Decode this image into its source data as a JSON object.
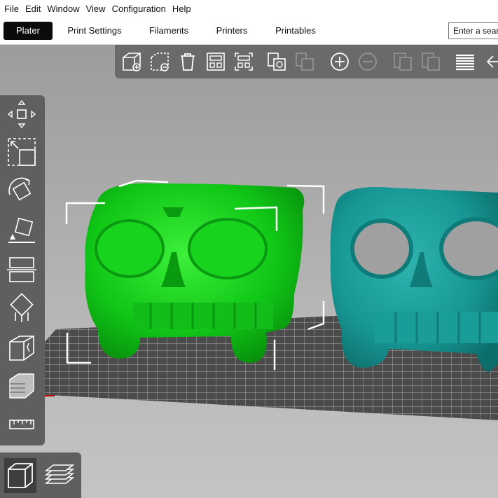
{
  "menu": [
    "File",
    "Edit",
    "Window",
    "View",
    "Configuration",
    "Help"
  ],
  "tabs": [
    {
      "label": "Plater",
      "active": true
    },
    {
      "label": "Print Settings",
      "active": false
    },
    {
      "label": "Filaments",
      "active": false
    },
    {
      "label": "Printers",
      "active": false
    },
    {
      "label": "Printables",
      "active": false
    }
  ],
  "search": {
    "placeholder": "Enter a search term"
  },
  "top_toolbar": [
    "add-object-icon",
    "delete-object-icon",
    "delete-all-icon",
    "arrange-icon",
    "arrange-selection-icon",
    "copy-icon",
    "paste-icon",
    "add-instance-icon",
    "remove-instance-icon",
    "split-objects-icon",
    "split-parts-icon",
    "layers-editing-icon",
    "undo-icon"
  ],
  "left_toolbar": [
    "move-icon",
    "scale-icon",
    "rotate-icon",
    "place-on-face-icon",
    "cut-icon",
    "supports-painting-icon",
    "seam-painting-icon",
    "variable-layer-icon",
    "measure-icon"
  ],
  "bottom_toolbar": [
    "3d-view-icon",
    "preview-icon"
  ],
  "colors": {
    "selected_object": "#12c81a",
    "other_object": "#1a9c98",
    "toolbar": "#6a6a6a",
    "active_tab": "#0b0b0b"
  }
}
